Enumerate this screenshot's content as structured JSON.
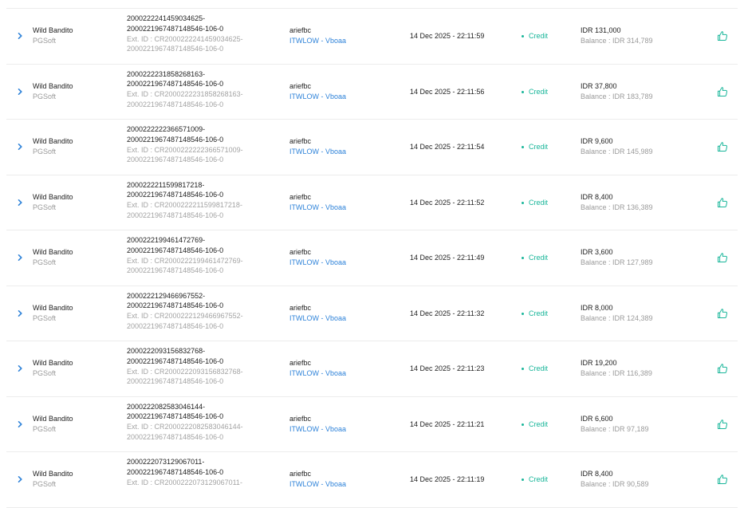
{
  "colors": {
    "credit": "#19b69a",
    "link": "#2f83d9",
    "muted": "#9a9a9a"
  },
  "icons": {
    "expand": "chevron-right-icon",
    "action": "thumbs-up-icon"
  },
  "rows": [
    {
      "game": "Wild Bandito",
      "provider": "PGSoft",
      "tx_line1": "2000222241459034625-",
      "tx_line2": "2000221967487148546-106-0",
      "ext_line1": "Ext. ID : CR2000222241459034625-",
      "ext_line2": "2000221967487148546-106-0",
      "user": "ariefbc",
      "site": "ITWLOW - Vboaa",
      "date": "14 Dec 2025 - 22:11:59",
      "status": "Credit",
      "amount": "IDR 131,000",
      "balance": "Balance : IDR 314,789"
    },
    {
      "game": "Wild Bandito",
      "provider": "PGSoft",
      "tx_line1": "2000222231858268163-",
      "tx_line2": "2000221967487148546-106-0",
      "ext_line1": "Ext. ID : CR2000222231858268163-",
      "ext_line2": "2000221967487148546-106-0",
      "user": "ariefbc",
      "site": "ITWLOW - Vboaa",
      "date": "14 Dec 2025 - 22:11:56",
      "status": "Credit",
      "amount": "IDR 37,800",
      "balance": "Balance : IDR 183,789"
    },
    {
      "game": "Wild Bandito",
      "provider": "PGSoft",
      "tx_line1": "2000222222366571009-",
      "tx_line2": "2000221967487148546-106-0",
      "ext_line1": "Ext. ID : CR2000222222366571009-",
      "ext_line2": "2000221967487148546-106-0",
      "user": "ariefbc",
      "site": "ITWLOW - Vboaa",
      "date": "14 Dec 2025 - 22:11:54",
      "status": "Credit",
      "amount": "IDR 9,600",
      "balance": "Balance : IDR 145,989"
    },
    {
      "game": "Wild Bandito",
      "provider": "PGSoft",
      "tx_line1": "2000222211599817218-",
      "tx_line2": "2000221967487148546-106-0",
      "ext_line1": "Ext. ID : CR2000222211599817218-",
      "ext_line2": "2000221967487148546-106-0",
      "user": "ariefbc",
      "site": "ITWLOW - Vboaa",
      "date": "14 Dec 2025 - 22:11:52",
      "status": "Credit",
      "amount": "IDR 8,400",
      "balance": "Balance : IDR 136,389"
    },
    {
      "game": "Wild Bandito",
      "provider": "PGSoft",
      "tx_line1": "2000222199461472769-",
      "tx_line2": "2000221967487148546-106-0",
      "ext_line1": "Ext. ID : CR2000222199461472769-",
      "ext_line2": "2000221967487148546-106-0",
      "user": "ariefbc",
      "site": "ITWLOW - Vboaa",
      "date": "14 Dec 2025 - 22:11:49",
      "status": "Credit",
      "amount": "IDR 3,600",
      "balance": "Balance : IDR 127,989"
    },
    {
      "game": "Wild Bandito",
      "provider": "PGSoft",
      "tx_line1": "2000222129466967552-",
      "tx_line2": "2000221967487148546-106-0",
      "ext_line1": "Ext. ID : CR2000222129466967552-",
      "ext_line2": "2000221967487148546-106-0",
      "user": "ariefbc",
      "site": "ITWLOW - Vboaa",
      "date": "14 Dec 2025 - 22:11:32",
      "status": "Credit",
      "amount": "IDR 8,000",
      "balance": "Balance : IDR 124,389"
    },
    {
      "game": "Wild Bandito",
      "provider": "PGSoft",
      "tx_line1": "2000222093156832768-",
      "tx_line2": "2000221967487148546-106-0",
      "ext_line1": "Ext. ID : CR2000222093156832768-",
      "ext_line2": "2000221967487148546-106-0",
      "user": "ariefbc",
      "site": "ITWLOW - Vboaa",
      "date": "14 Dec 2025 - 22:11:23",
      "status": "Credit",
      "amount": "IDR 19,200",
      "balance": "Balance : IDR 116,389"
    },
    {
      "game": "Wild Bandito",
      "provider": "PGSoft",
      "tx_line1": "2000222082583046144-",
      "tx_line2": "2000221967487148546-106-0",
      "ext_line1": "Ext. ID : CR2000222082583046144-",
      "ext_line2": "2000221967487148546-106-0",
      "user": "ariefbc",
      "site": "ITWLOW - Vboaa",
      "date": "14 Dec 2025 - 22:11:21",
      "status": "Credit",
      "amount": "IDR 6,600",
      "balance": "Balance : IDR 97,189"
    },
    {
      "game": "Wild Bandito",
      "provider": "PGSoft",
      "tx_line1": "2000222073129067011-",
      "tx_line2": "2000221967487148546-106-0",
      "ext_line1": "Ext. ID : CR2000222073129067011-",
      "ext_line2": "",
      "user": "ariefbc",
      "site": "ITWLOW - Vboaa",
      "date": "14 Dec 2025 - 22:11:19",
      "status": "Credit",
      "amount": "IDR 8,400",
      "balance": "Balance : IDR 90,589"
    }
  ]
}
